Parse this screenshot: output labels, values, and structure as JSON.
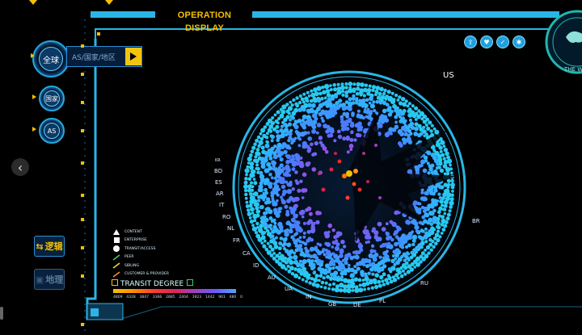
{
  "header": {
    "title": "OPERATION DISPLAY"
  },
  "sidebar": {
    "global_label": "全球",
    "country_label": "国家",
    "as_label": "AS",
    "select_placeholder": "AS/国家/地区",
    "logic_label": "逻辑",
    "geo_label": "地理"
  },
  "toolbar": {
    "icons": [
      "share-icon",
      "heart-icon",
      "check-icon",
      "settings-icon"
    ]
  },
  "badge": {
    "text": "THE W"
  },
  "legend": {
    "items": [
      {
        "symbol": "triangle",
        "label": "CONTENT"
      },
      {
        "symbol": "square",
        "label": "ENTERPRISE"
      },
      {
        "symbol": "circle",
        "label": "TRANSIT/ACCESS"
      },
      {
        "symbol": "line-green",
        "label": "PEER"
      },
      {
        "symbol": "line-yellow",
        "label": "SIBLING"
      },
      {
        "symbol": "line-orange",
        "label": "CUSTOMER & PROVIDER"
      }
    ],
    "transit_title": "TRANSIT DEGREE",
    "gradient_labels": [
      "4809",
      "4328",
      "3847",
      "3366",
      "2885",
      "2404",
      "1923",
      "1442",
      "961",
      "480",
      "0"
    ]
  },
  "countries": {
    "US": "US",
    "BR": "BR",
    "RU": "RU",
    "PL": "PL",
    "DE": "DE",
    "GB": "GB",
    "IN": "IN",
    "UA": "UA",
    "AU": "AU",
    "ID": "ID",
    "CA": "CA",
    "FR": "FR",
    "NL": "NL",
    "RO": "RO",
    "IT": "IT",
    "AR": "AR",
    "ES": "ES",
    "BD": "BD",
    "KR": "KR"
  },
  "colors": {
    "accent": "#29b6e6",
    "title": "#f5c000",
    "background": "#000000"
  }
}
